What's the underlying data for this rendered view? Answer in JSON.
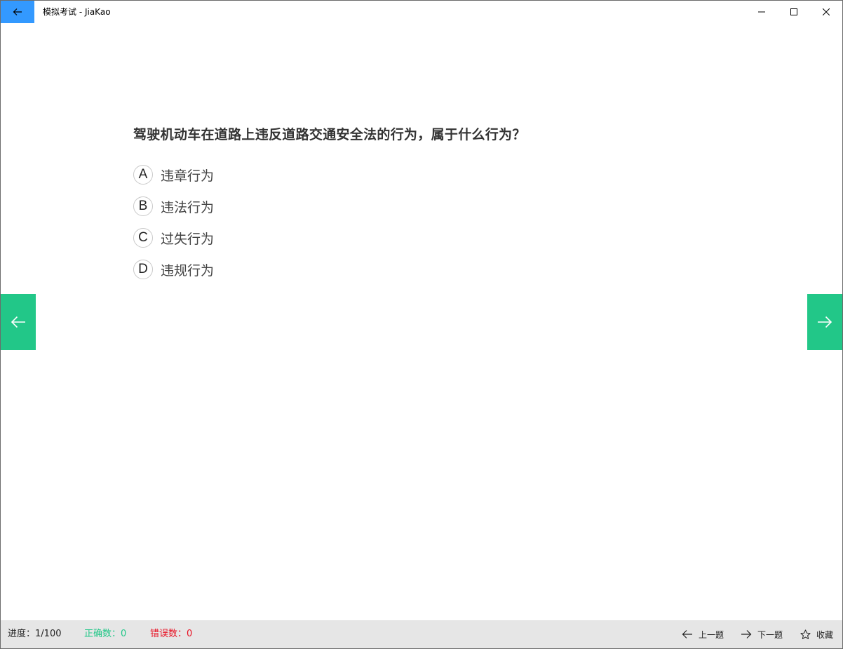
{
  "titlebar": {
    "title": "模拟考试 - JiaKao",
    "back_icon": "arrow-left-icon",
    "accent_color": "#3399ff"
  },
  "question": {
    "text": "驾驶机动车在道路上违反道路交通安全法的行为，属于什么行为？",
    "options": [
      {
        "letter": "A",
        "text": "违章行为"
      },
      {
        "letter": "B",
        "text": "违法行为"
      },
      {
        "letter": "C",
        "text": "过失行为"
      },
      {
        "letter": "D",
        "text": "违规行为"
      }
    ]
  },
  "side_nav": {
    "prev_icon": "arrow-left-icon",
    "next_icon": "arrow-right-icon",
    "color": "#22c788"
  },
  "status": {
    "progress_label": "进度：",
    "progress_value": "1/100",
    "correct_label": "正确数：",
    "correct_value": "0",
    "wrong_label": "错误数：",
    "wrong_value": "0",
    "correct_color": "#22c788",
    "wrong_color": "#e81123"
  },
  "actions": {
    "prev_label": "上一题",
    "next_label": "下一题",
    "favorite_label": "收藏"
  }
}
